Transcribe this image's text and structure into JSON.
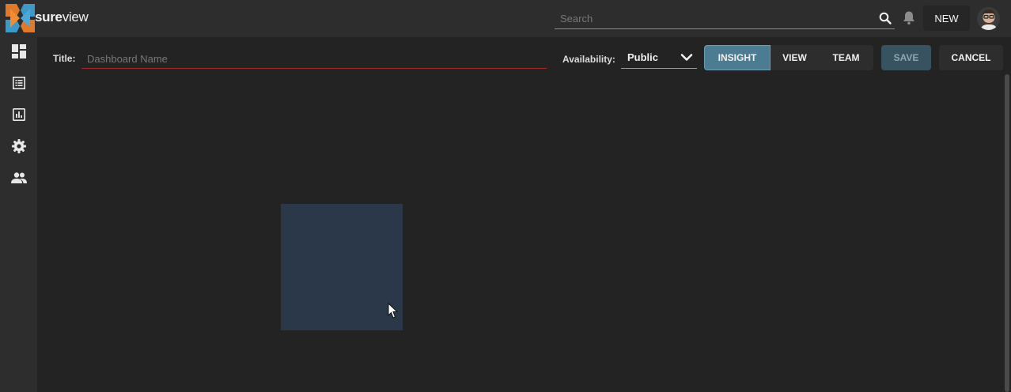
{
  "app": {
    "brand_bold": "sure",
    "brand_thin": "view"
  },
  "topbar": {
    "search_placeholder": "Search",
    "new_label": "NEW"
  },
  "sidebar": {
    "items": [
      {
        "icon": "dashboard-icon"
      },
      {
        "icon": "list-icon"
      },
      {
        "icon": "report-icon"
      },
      {
        "icon": "gear-icon"
      },
      {
        "icon": "people-icon"
      }
    ]
  },
  "editor": {
    "title_label": "Title:",
    "title_placeholder": "Dashboard Name",
    "availability_label": "Availability:",
    "availability_value": "Public",
    "modes": [
      "INSIGHT",
      "VIEW",
      "TEAM"
    ],
    "active_mode": "INSIGHT",
    "save_label": "SAVE",
    "cancel_label": "CANCEL"
  },
  "colors": {
    "accent": "#4b7c92",
    "title_underline": "#a02a2a",
    "placeholder_tile": "#2b384a"
  }
}
